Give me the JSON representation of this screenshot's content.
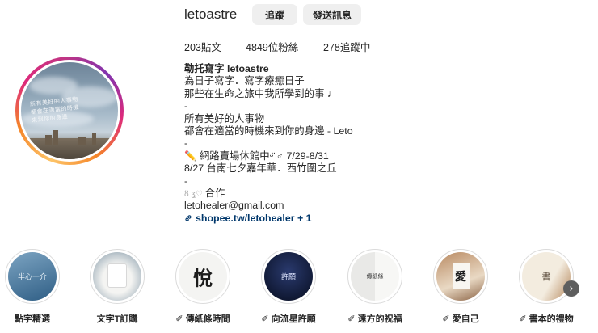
{
  "profile": {
    "username": "letoastre",
    "follow_label": "追蹤",
    "message_label": "發送訊息"
  },
  "stats": {
    "posts": "203貼文",
    "followers": "4849位粉絲",
    "following": "278追蹤中"
  },
  "bio": {
    "name": "勒托寫字 letoastre",
    "lines": [
      "為日子寫字．寫字療癒日子",
      "那些在生命之旅中我所學到的事 ♩",
      "-",
      "所有美好的人事物",
      "都會在適當的時機來到你的身邊 - Leto",
      "-",
      "✏️ 網路賣場休館中ᵕ̈ ♂ 7/29-8/31",
      "8/27 台南七夕嘉年華．西竹圍之丘",
      "-",
      "合作",
      "letohealer@gmail.com"
    ],
    "link": "shopee.tw/letohealer + 1"
  },
  "highlights": [
    {
      "label": "點字精選",
      "glyph": "半心一介"
    },
    {
      "label": "文字T訂購",
      "glyph": ""
    },
    {
      "label": "✐ 傳紙條時間",
      "glyph": "悅"
    },
    {
      "label": "✐ 向流星許願",
      "glyph": "許願"
    },
    {
      "label": "✐ 遠方的祝福",
      "glyph": "傳紙條"
    },
    {
      "label": "✐ 愛自己",
      "glyph": "愛"
    },
    {
      "label": "✐ 書本的禮物",
      "glyph": "書"
    }
  ],
  "icons": {
    "next": "chevron-right-icon",
    "link": "link-icon"
  },
  "colors": {
    "link": "#00376b",
    "button_bg": "#efefef"
  }
}
